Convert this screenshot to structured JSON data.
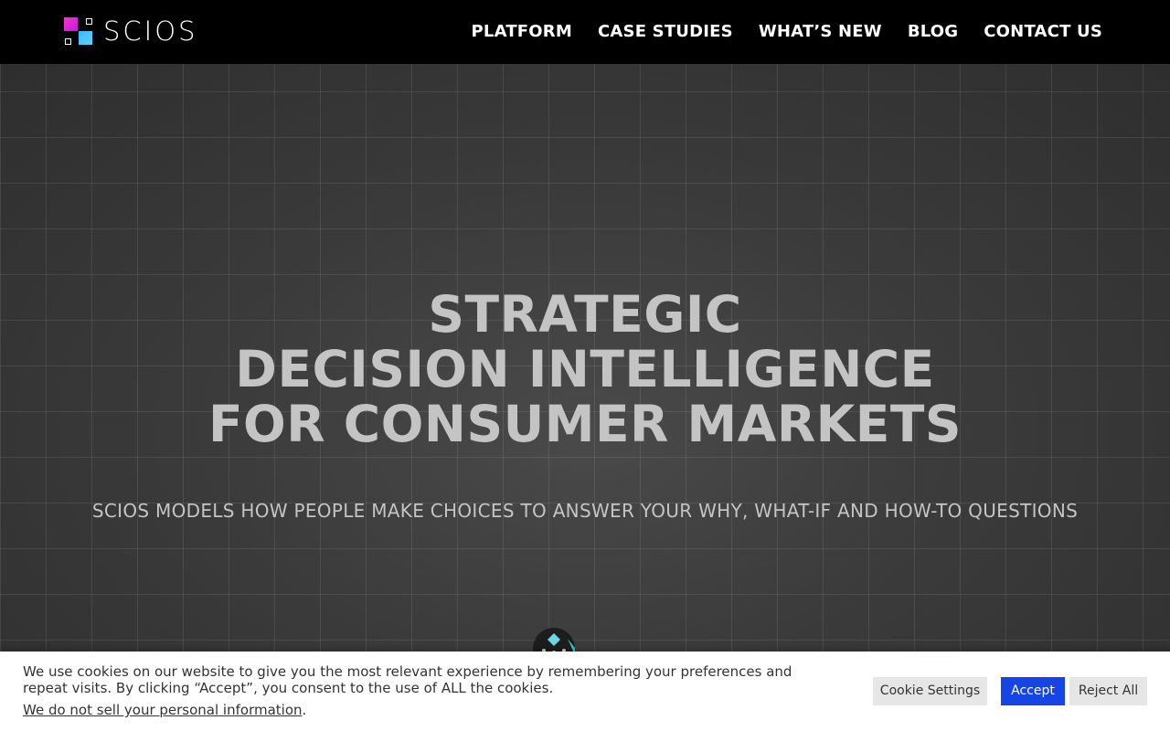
{
  "brand": {
    "name": "SCIOS"
  },
  "nav": {
    "items": [
      {
        "label": "PLATFORM"
      },
      {
        "label": "CASE STUDIES"
      },
      {
        "label": "WHAT’S NEW"
      },
      {
        "label": "BLOG"
      },
      {
        "label": "CONTACT US"
      }
    ]
  },
  "hero": {
    "headline": [
      "STRATEGIC",
      "DECISION INTELLIGENCE",
      "FOR CONSUMER MARKETS"
    ],
    "subheadline": "SCIOS MODELS HOW PEOPLE MAKE CHOICES TO ANSWER YOUR WHY, WHAT-IF AND HOW-TO QUESTIONS",
    "icon": "diamond-network-icon"
  },
  "cookie_banner": {
    "message": "We use cookies on our website to give you the most relevant experience by remembering your preferences and repeat visits. By clicking “Accept”, you consent to the use of ALL the cookies.",
    "do_not_sell_link": "We do not sell your personal information",
    "link_suffix": ".",
    "settings_label": "Cookie Settings",
    "accept_label": "Accept",
    "reject_label": "Reject All"
  },
  "colors": {
    "nav_bg": "#000000",
    "accept_button": "#1744e4",
    "logo_magenta": "#e022d6",
    "logo_blue": "#3fbdf8"
  }
}
